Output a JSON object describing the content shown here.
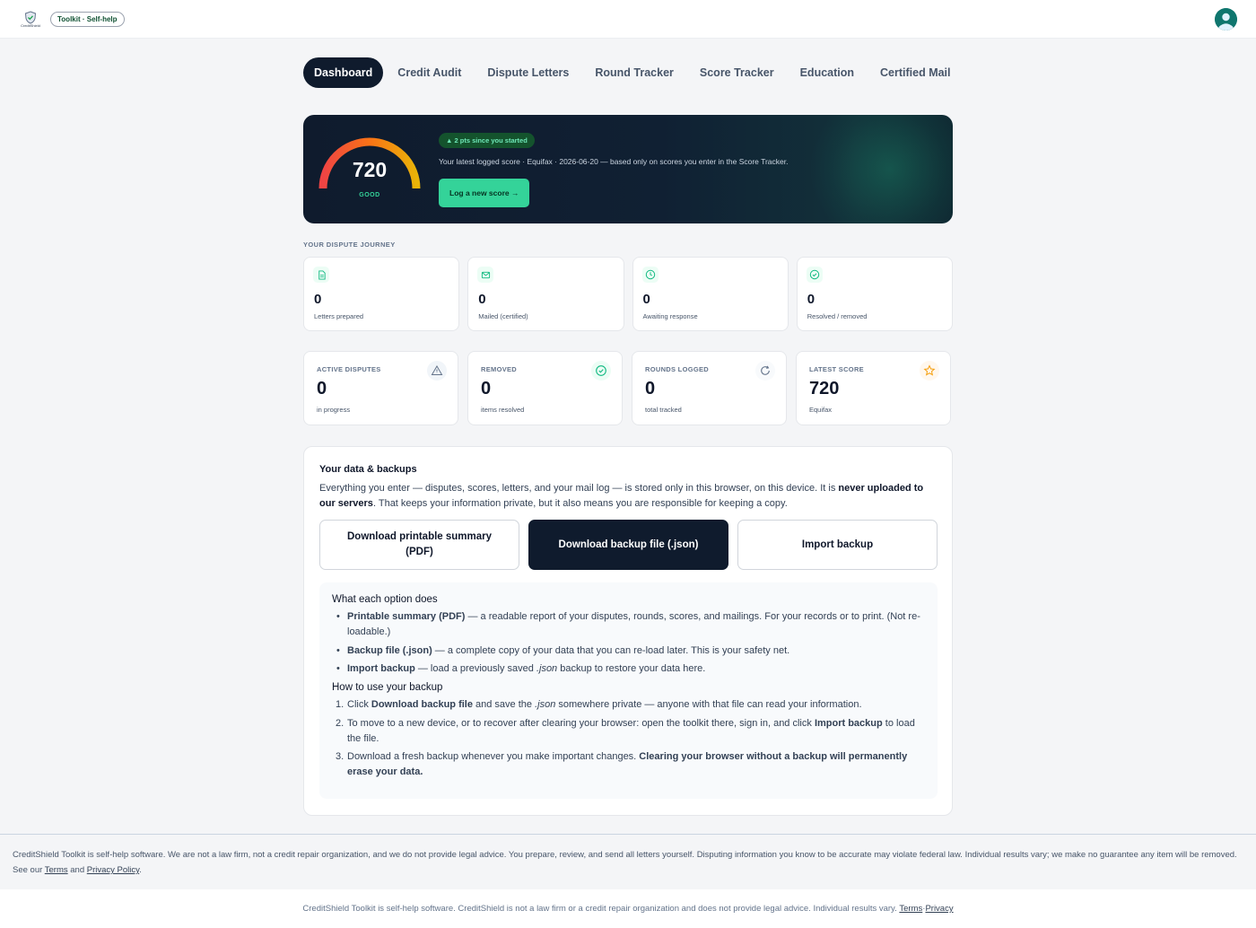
{
  "header": {
    "logo_text": "CreditShield",
    "toolkit_pill": "Toolkit · Self-help"
  },
  "tabs": [
    {
      "label": "Dashboard",
      "active": true
    },
    {
      "label": "Credit Audit",
      "active": false
    },
    {
      "label": "Dispute Letters",
      "active": false
    },
    {
      "label": "Round Tracker",
      "active": false
    },
    {
      "label": "Score Tracker",
      "active": false
    },
    {
      "label": "Education",
      "active": false
    },
    {
      "label": "Certified Mail",
      "active": false
    }
  ],
  "hero": {
    "score": "720",
    "rating": "GOOD",
    "change_badge": "▲ 2 pts since you started",
    "description": "Your latest logged score · Equifax · 2026-06-20 — based only on scores you enter in the Score Tracker.",
    "log_button": "Log a new score →"
  },
  "journey": {
    "label": "YOUR DISPUTE JOURNEY",
    "cards": [
      {
        "icon": "document-icon",
        "value": "0",
        "label": "Letters prepared"
      },
      {
        "icon": "mail-icon",
        "value": "0",
        "label": "Mailed (certified)"
      },
      {
        "icon": "clock-icon",
        "value": "0",
        "label": "Awaiting response"
      },
      {
        "icon": "check-circle-icon",
        "value": "0",
        "label": "Resolved / removed"
      }
    ]
  },
  "stats": [
    {
      "title": "ACTIVE DISPUTES",
      "value": "0",
      "sub": "in progress",
      "icon": "warning-icon"
    },
    {
      "title": "REMOVED",
      "value": "0",
      "sub": "items resolved",
      "icon": "check-circle-icon"
    },
    {
      "title": "ROUNDS LOGGED",
      "value": "0",
      "sub": "total tracked",
      "icon": "refresh-icon"
    },
    {
      "title": "LATEST SCORE",
      "value": "720",
      "sub": "Equifax",
      "icon": "star-icon"
    }
  ],
  "data_backups": {
    "title": "Your data & backups",
    "desc_part1": "Everything you enter — disputes, scores, letters, and your mail log — is stored only in this browser, on this device. It is ",
    "desc_bold": "never uploaded to our servers",
    "desc_part2": ". That keeps your information private, but it also means you are responsible for keeping a copy.",
    "buttons": {
      "pdf": "Download printable summary (PDF)",
      "json": "Download backup file (.json)",
      "import": "Import backup"
    },
    "options_heading": "What each option does",
    "options": [
      {
        "bold": "Printable summary (PDF)",
        "text": " — a readable report of your disputes, rounds, scores, and mailings. For your records or to print. (Not re-loadable.)"
      },
      {
        "bold": "Backup file (.json)",
        "text": " — a complete copy of your data that you can re-load later. This is your safety net."
      },
      {
        "bold": "Import backup",
        "text_a": " — load a previously saved ",
        "italic": ".json",
        "text_b": " backup to restore your data here."
      }
    ],
    "howto_heading": "How to use your backup",
    "howto": [
      {
        "n": "1.",
        "a": "Click ",
        "bold": "Download backup file",
        "b": " and save the ",
        "italic": ".json",
        "c": " somewhere private — anyone with that file can read your information."
      },
      {
        "n": "2.",
        "a": "To move to a new device, or to recover after clearing your browser: open the toolkit there, sign in, and click ",
        "bold": "Import backup",
        "b": " to load the file."
      },
      {
        "n": "3.",
        "a": "Download a fresh backup whenever you make important changes. ",
        "bold": "Clearing your browser without a backup will permanently erase your data."
      }
    ]
  },
  "footer1": {
    "text": "CreditShield Toolkit is self-help software. We are not a law firm, not a credit repair organization, and we do not provide legal advice. You prepare, review, and send all letters yourself. Disputing information you know to be accurate may violate federal law. Individual results vary; we make no guarantee any item will be removed. See our ",
    "terms": "Terms",
    "and": " and ",
    "privacy": "Privacy Policy",
    "end": "."
  },
  "footer2": {
    "text": "CreditShield Toolkit is self-help software. CreditShield is not a law firm or a credit repair organization and does not provide legal advice. Individual results vary. ",
    "terms": "Terms",
    "sep": " · ",
    "privacy": "Privacy"
  },
  "colors": {
    "navy": "#0f1b2d",
    "accent_green": "#34d399",
    "warn": "#f59e0b"
  }
}
